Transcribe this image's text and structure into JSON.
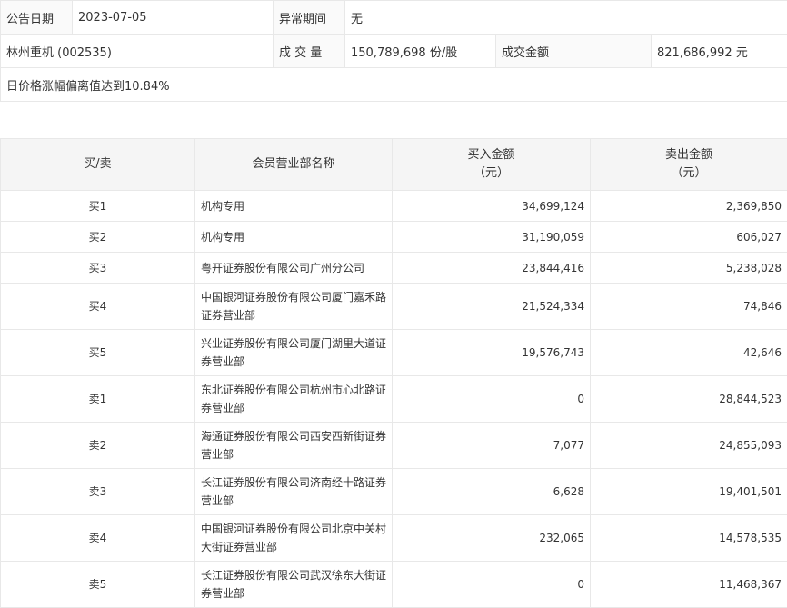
{
  "info": {
    "date_label": "公告日期",
    "date": "2023-07-05",
    "period_label": "异常期间",
    "period": "无",
    "stock": "林州重机 (002535)",
    "volume_label": "成 交 量",
    "volume": "150,789,698 份/股",
    "amount_label": "成交金额",
    "amount": "821,686,992 元",
    "reason": "日价格涨幅偏离值达到10.84%"
  },
  "table": {
    "headers": {
      "side": "买/卖",
      "name": "会员营业部名称",
      "buy": "买入金额",
      "buy_unit": "（元）",
      "sell": "卖出金额",
      "sell_unit": "（元）"
    },
    "rows": [
      {
        "side": "买1",
        "name": "机构专用",
        "buy": "34,699,124",
        "sell": "2,369,850"
      },
      {
        "side": "买2",
        "name": "机构专用",
        "buy": "31,190,059",
        "sell": "606,027"
      },
      {
        "side": "买3",
        "name": "粤开证券股份有限公司广州分公司",
        "buy": "23,844,416",
        "sell": "5,238,028"
      },
      {
        "side": "买4",
        "name": "中国银河证券股份有限公司厦门嘉禾路证券营业部",
        "buy": "21,524,334",
        "sell": "74,846"
      },
      {
        "side": "买5",
        "name": "兴业证券股份有限公司厦门湖里大道证券营业部",
        "buy": "19,576,743",
        "sell": "42,646"
      },
      {
        "side": "卖1",
        "name": "东北证券股份有限公司杭州市心北路证券营业部",
        "buy": "0",
        "sell": "28,844,523"
      },
      {
        "side": "卖2",
        "name": "海通证券股份有限公司西安西新街证券营业部",
        "buy": "7,077",
        "sell": "24,855,093"
      },
      {
        "side": "卖3",
        "name": "长江证券股份有限公司济南经十路证券营业部",
        "buy": "6,628",
        "sell": "19,401,501"
      },
      {
        "side": "卖4",
        "name": "中国银河证券股份有限公司北京中关村大街证券营业部",
        "buy": "232,065",
        "sell": "14,578,535"
      },
      {
        "side": "卖5",
        "name": "长江证券股份有限公司武汉徐东大街证券营业部",
        "buy": "0",
        "sell": "11,468,367"
      }
    ]
  }
}
